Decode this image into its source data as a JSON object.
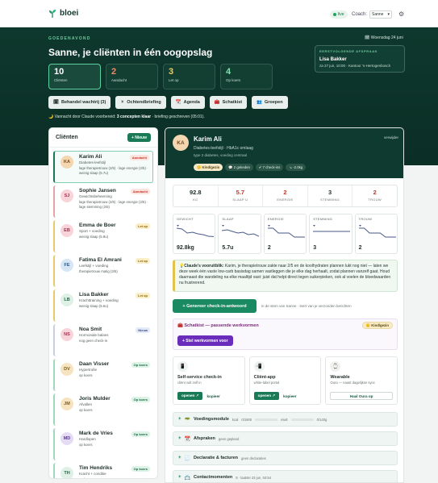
{
  "app": {
    "name": "bloei",
    "live_label": "live",
    "coach_label": "Coach:",
    "coach_value": "Sanne"
  },
  "greeting": {
    "small": "GOEDENAVOND",
    "date": "Woensdag 24 juni",
    "title": "Sanne, je cliënten in één oogopslag",
    "prep_prefix": "Vannacht door Claude voorbereid: ",
    "prep_bold": "3 concepten klaar",
    "prep_suffix": " · briefing geschreven (05:01)."
  },
  "next_appointment": {
    "label": "EERSTVOLGENDE AFSPRAAK",
    "name": "Lisa Bakker",
    "when": "za 27 jun, 10:00 · Kantoor 's-Hertogenbosch"
  },
  "stats": [
    {
      "num": "10",
      "cap": "Cliënten"
    },
    {
      "num": "2",
      "cap": "Aandacht",
      "color": "#f08a6a"
    },
    {
      "num": "3",
      "cap": "Let op",
      "color": "#f2cc5a"
    },
    {
      "num": "4",
      "cap": "Op koers",
      "color": "#7fe0b3"
    }
  ],
  "actions": [
    {
      "icon": "🗓",
      "label": "Behandel wachtrij (3)"
    },
    {
      "icon": "☀",
      "label": "Ochtendbriefing"
    },
    {
      "icon": "📆",
      "label": "Agenda"
    },
    {
      "icon": "🧰",
      "label": "Schatkist"
    },
    {
      "icon": "👥",
      "label": "Groepen"
    }
  ],
  "clients_panel": {
    "title": "Cliënten",
    "new_label": "+ Nieuw"
  },
  "clients": [
    {
      "initials": "KA",
      "name": "Karim Ali",
      "sub": "Diabetes-leefstijl",
      "meta": "lage therapietrouw (2/5) · lage energie (2/5) · weinig slaap (5.7u)",
      "badge": "Aandacht",
      "badge_bg": "#fde3de",
      "badge_fg": "#c0392b",
      "av_bg": "#f4d6b0",
      "av_fg": "#7a4a1f",
      "border": "#1a7a56"
    },
    {
      "initials": "SJ",
      "name": "Sophie Jansen",
      "sub": "Gewichtsbeheersing",
      "meta": "lage therapietrouw (2/5) · lage energie (2/5) · lage stemming (2/5)",
      "badge": "Aandacht",
      "badge_bg": "#fde3de",
      "badge_fg": "#c0392b",
      "av_bg": "#f8d3da",
      "av_fg": "#a33050",
      "border": "#e6a3a3"
    },
    {
      "initials": "EB",
      "name": "Emma de Boer",
      "sub": "Sport + voeding",
      "meta": "weinig slaap (5.8u)",
      "badge": "Let op",
      "badge_bg": "#fbefc8",
      "badge_fg": "#8a6410",
      "av_bg": "#f8d3da",
      "av_fg": "#a33050",
      "border": "#e7c96a"
    },
    {
      "initials": "FE",
      "name": "Fatima El Amrani",
      "sub": "Leefstijl + voeding",
      "meta": "therapietrouw matig (3/5)",
      "badge": "Let op",
      "badge_bg": "#fbefc8",
      "badge_fg": "#8a6410",
      "av_bg": "#d6e6f6",
      "av_fg": "#2a5a8a",
      "border": "#e7c96a"
    },
    {
      "initials": "LB",
      "name": "Lisa Bakker",
      "sub": "Krachttraining + voeding",
      "meta": "weinig slaap (5.6u)",
      "badge": "Let op",
      "badge_bg": "#fbefc8",
      "badge_fg": "#8a6410",
      "av_bg": "#dff0e6",
      "av_fg": "#1a6b48",
      "border": "#e7c96a"
    },
    {
      "initials": "NS",
      "name": "Noa Smit",
      "sub": "Hormonale balans",
      "meta": "nog geen check-in",
      "badge": "Nieuw",
      "badge_bg": "#e4e9f7",
      "badge_fg": "#3a4f8a",
      "av_bg": "#f8d3da",
      "av_fg": "#a33050",
      "border": "#c7cfe6"
    },
    {
      "initials": "DV",
      "name": "Daan Visser",
      "sub": "Hypertrofie",
      "meta": "op koers",
      "badge": "Op koers",
      "badge_bg": "#dcf3e6",
      "badge_fg": "#1a6b48",
      "av_bg": "#f6e3c0",
      "av_fg": "#7a5a1f",
      "border": "#9fd8bb"
    },
    {
      "initials": "JM",
      "name": "Joris Mulder",
      "sub": "Afvallen",
      "meta": "op koers",
      "badge": "Op koers",
      "badge_bg": "#dcf3e6",
      "badge_fg": "#1a6b48",
      "av_bg": "#f6e3c0",
      "av_fg": "#7a5a1f",
      "border": "#9fd8bb"
    },
    {
      "initials": "MD",
      "name": "Mark de Vries",
      "sub": "Hardlopen",
      "meta": "op koers",
      "badge": "Op koers",
      "badge_bg": "#dcf3e6",
      "badge_fg": "#1a6b48",
      "av_bg": "#e4dcf4",
      "av_fg": "#5a3a8a",
      "border": "#9fd8bb"
    },
    {
      "initials": "TH",
      "name": "Tim Hendriks",
      "sub": "Kracht + conditie",
      "meta": "op koers",
      "badge": "Op koers",
      "badge_bg": "#dcf3e6",
      "badge_fg": "#1a6b48",
      "av_bg": "#dff0e6",
      "av_fg": "#1a6b48",
      "border": "#9fd8bb"
    }
  ],
  "detail": {
    "initials": "KA",
    "name": "Karim Ali",
    "sub1": "Diabetes-leefstijl · HbA1c omlaag",
    "sub2": "type 2 diabetes, voeding centraal",
    "delete_label": "verwijder",
    "chips": [
      {
        "label": "🙂 Kind/gezin",
        "kind": true
      },
      {
        "label": "💬 2 gekeden",
        "kind": false
      },
      {
        "label": "✔ 7 check-ins",
        "kind": false
      },
      {
        "label": "↘ -2.0kg",
        "kind": false
      }
    ],
    "metrics": [
      {
        "v": "92.8",
        "l": "KG",
        "red": false
      },
      {
        "v": "5.7",
        "l": "SLAAP U",
        "red": true
      },
      {
        "v": "2",
        "l": "ENERGIE",
        "red": true
      },
      {
        "v": "3",
        "l": "STEMMING",
        "red": false
      },
      {
        "v": "2",
        "l": "TROUW",
        "red": true
      }
    ],
    "sparklines": [
      {
        "label": "GEWICHT",
        "value": "92.8kg",
        "points": [
          0.2,
          0.25,
          0.5,
          0.45,
          0.55,
          0.6,
          0.7,
          0.72
        ],
        "color": "#4a5a8a"
      },
      {
        "label": "SLAAP",
        "value": "5.7u",
        "points": [
          0.35,
          0.3,
          0.4,
          0.5,
          0.45,
          0.6,
          0.55,
          0.7
        ],
        "color": "#4a5a8a"
      },
      {
        "label": "ENERGIE",
        "value": "2",
        "points": [
          0.2,
          0.2,
          0.5,
          0.5,
          0.5,
          0.75,
          0.75,
          0.75
        ],
        "color": "#4a5a8a"
      },
      {
        "label": "STEMMING",
        "value": "3",
        "points": [
          0.4,
          0.4,
          0.4,
          0.4,
          0.4,
          0.4,
          0.4,
          0.4
        ],
        "color": "#4a5a8a"
      },
      {
        "label": "TROUW",
        "value": "2",
        "points": [
          0.2,
          0.2,
          0.5,
          0.5,
          0.5,
          0.75,
          0.75,
          0.75
        ],
        "color": "#4a5a8a"
      }
    ],
    "claude_view_title": "Claude's vooruitblik:",
    "claude_view_text": " Karim, je therapietrouw zakte naar 2/5 en de koolhydraten plannen lukt nog niet — laten we deze week één vaste low-carb basisdag samen vastleggen die je elke dag herhaalt, zodat plannen vanzelf gaat. Houd daarnaast die wandeling na elke maaltijd vast: juist dat helpt direct tegen suikerpieken, ook al voelen de bloedwaarden nu frustrerend.",
    "generate_label": "+ Genereer check-in-antwoord",
    "generate_hint": "in de stem van Sanne · leert van je verzonden berichten",
    "toolkit": {
      "title": "🧰 Schatkist — passende werkvormen",
      "kind": "🙂 Kind/gezin",
      "button": "+ Stel werkvormen voor"
    },
    "tools": [
      {
        "icon": "📱",
        "title": "Self-service check-in",
        "sub": "cliënt vult zelf in",
        "open": "openen ↗",
        "copy": "kopieer"
      },
      {
        "icon": "📲",
        "title": "Cliënt-app",
        "sub": "white-label portal",
        "open": "openen ↗",
        "copy": "kopieer"
      },
      {
        "icon": "⌚",
        "title": "Wearable",
        "sub": "Oura — naast dagelijkse sync",
        "button": "Haal Oura op"
      }
    ],
    "sections": [
      {
        "icon": "🥗",
        "title": "Voedingsmodule",
        "meta1": "kcal",
        "meta2": "0/1900",
        "meta3": "eiwit",
        "meta4": "0/140g"
      },
      {
        "icon": "📆",
        "title": "Afspraken",
        "meta": "geen gepland"
      },
      {
        "icon": "🧾",
        "title": "Declaratie & facturen",
        "meta": "geen declaraties"
      },
      {
        "icon": "📇",
        "title": "Contactmomenten",
        "meta": "9 · laatste 23 jun, 04:54"
      }
    ]
  }
}
